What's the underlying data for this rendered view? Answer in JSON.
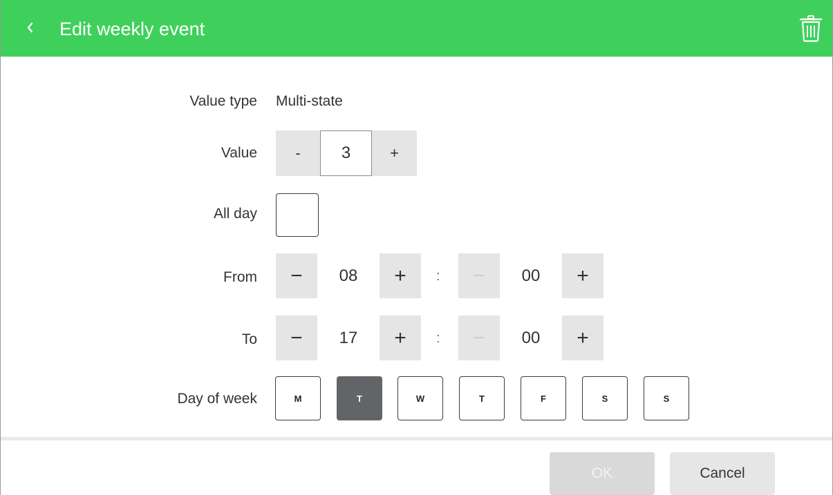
{
  "header": {
    "title": "Edit weekly event",
    "background": "#3fd05c",
    "back_icon": "chevron-left-icon",
    "delete_icon": "trash-icon"
  },
  "form": {
    "value_type": {
      "label": "Value type",
      "value": "Multi-state"
    },
    "value": {
      "label": "Value",
      "decrement": "-",
      "current": "3",
      "increment": "+"
    },
    "all_day": {
      "label": "All day",
      "checked": false
    },
    "from": {
      "label": "From",
      "hour": "08",
      "minute": "00",
      "separator": ":",
      "decrement": "−",
      "increment": "+"
    },
    "to": {
      "label": "To",
      "hour": "17",
      "minute": "00",
      "separator": ":",
      "decrement": "−",
      "increment": "+"
    },
    "day_of_week": {
      "label": "Day of week",
      "days": [
        {
          "letter": "M",
          "selected": false
        },
        {
          "letter": "T",
          "selected": true
        },
        {
          "letter": "W",
          "selected": false
        },
        {
          "letter": "T",
          "selected": false
        },
        {
          "letter": "F",
          "selected": false
        },
        {
          "letter": "S",
          "selected": false
        },
        {
          "letter": "S",
          "selected": false
        }
      ]
    }
  },
  "footer": {
    "ok_label": "OK",
    "ok_enabled": false,
    "cancel_label": "Cancel"
  },
  "colors": {
    "accent": "#3fd05c",
    "selected_day": "#636467",
    "stepper_bg": "#e5e5e5"
  }
}
